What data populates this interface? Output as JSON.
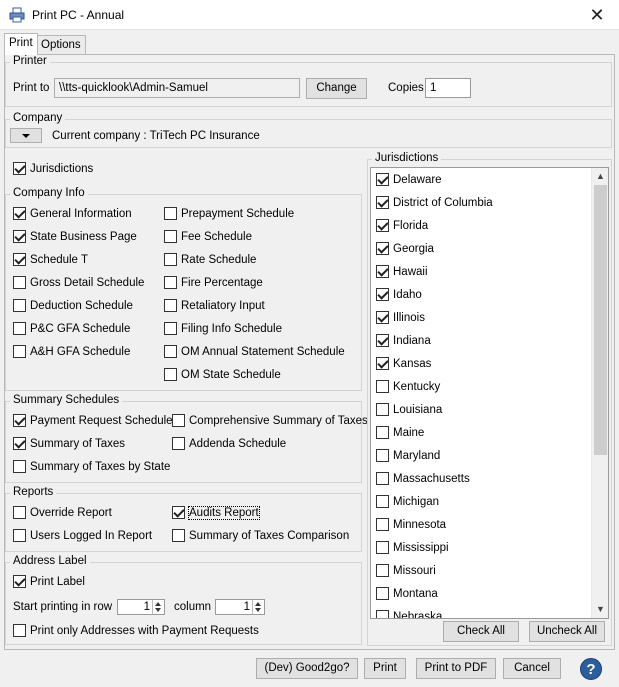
{
  "window": {
    "title": "Print PC - Annual",
    "close_glyph": "✕"
  },
  "tabs": [
    {
      "label": "Print"
    },
    {
      "label": "Options"
    }
  ],
  "printer": {
    "group_label": "Printer",
    "print_to_label": "Print to",
    "print_to_value": "\\\\tts-quicklook\\Admin-Samuel",
    "change_label": "Change",
    "copies_label": "Copies",
    "copies_value": "1"
  },
  "company": {
    "group_label": "Company",
    "current": "Current company : TriTech PC Insurance"
  },
  "jurisdictions_checkbox": {
    "label": "Jurisdictions",
    "checked": true
  },
  "company_info": {
    "group_label": "Company Info",
    "left": [
      {
        "label": "General Information",
        "checked": true
      },
      {
        "label": "State Business Page",
        "checked": true
      },
      {
        "label": "Schedule T",
        "checked": true
      },
      {
        "label": "Gross Detail Schedule",
        "checked": false
      },
      {
        "label": "Deduction Schedule",
        "checked": false
      },
      {
        "label": "P&C GFA Schedule",
        "checked": false
      },
      {
        "label": "A&H GFA Schedule",
        "checked": false
      }
    ],
    "right": [
      {
        "label": "Prepayment Schedule",
        "checked": false
      },
      {
        "label": "Fee Schedule",
        "checked": false
      },
      {
        "label": "Rate Schedule",
        "checked": false
      },
      {
        "label": "Fire Percentage",
        "checked": false
      },
      {
        "label": "Retaliatory Input",
        "checked": false
      },
      {
        "label": "Filing Info Schedule",
        "checked": false
      },
      {
        "label": "OM Annual Statement Schedule",
        "checked": false
      },
      {
        "label": "OM State Schedule",
        "checked": false
      }
    ]
  },
  "summary_schedules": {
    "group_label": "Summary Schedules",
    "items": [
      {
        "label": "Payment Request Schedule",
        "checked": true
      },
      {
        "label": "Comprehensive Summary of Taxes",
        "checked": false
      },
      {
        "label": "Summary of Taxes",
        "checked": true
      },
      {
        "label": "Addenda Schedule",
        "checked": false
      },
      {
        "label": "Summary of Taxes by State",
        "checked": false
      }
    ]
  },
  "reports": {
    "group_label": "Reports",
    "items": [
      {
        "label": "Override Report",
        "checked": false
      },
      {
        "label": "Audits Report",
        "checked": true
      },
      {
        "label": "Users Logged In Report",
        "checked": false
      },
      {
        "label": "Summary of Taxes Comparison",
        "checked": false
      }
    ]
  },
  "address_label": {
    "group_label": "Address Label",
    "print_label": {
      "label": "Print Label",
      "checked": true
    },
    "start_row_label": "Start printing in row",
    "row_value": "1",
    "column_label": "column",
    "column_value": "1",
    "only_payment": {
      "label": "Print only Addresses with Payment Requests",
      "checked": false
    }
  },
  "jurisdictions_panel": {
    "group_label": "Jurisdictions",
    "items": [
      {
        "label": "Delaware",
        "checked": true
      },
      {
        "label": "District of Columbia",
        "checked": true
      },
      {
        "label": "Florida",
        "checked": true
      },
      {
        "label": "Georgia",
        "checked": true
      },
      {
        "label": "Hawaii",
        "checked": true
      },
      {
        "label": "Idaho",
        "checked": true
      },
      {
        "label": "Illinois",
        "checked": true
      },
      {
        "label": "Indiana",
        "checked": true
      },
      {
        "label": "Kansas",
        "checked": true
      },
      {
        "label": "Kentucky",
        "checked": false
      },
      {
        "label": "Louisiana",
        "checked": false
      },
      {
        "label": "Maine",
        "checked": false
      },
      {
        "label": "Maryland",
        "checked": false
      },
      {
        "label": "Massachusetts",
        "checked": false
      },
      {
        "label": "Michigan",
        "checked": false
      },
      {
        "label": "Minnesota",
        "checked": false
      },
      {
        "label": "Mississippi",
        "checked": false
      },
      {
        "label": "Missouri",
        "checked": false
      },
      {
        "label": "Montana",
        "checked": false
      },
      {
        "label": "Nebraska",
        "checked": false
      }
    ],
    "check_all_label": "Check All",
    "uncheck_all_label": "Uncheck All"
  },
  "footer": {
    "dev_label": "(Dev) Good2go?",
    "print_label": "Print",
    "print_pdf_label": "Print to PDF",
    "cancel_label": "Cancel",
    "help_glyph": "?"
  },
  "icons": {
    "app": "printer-app-icon",
    "close": "close-icon",
    "dropdown": "chevron-down-icon",
    "help": "help-icon"
  }
}
